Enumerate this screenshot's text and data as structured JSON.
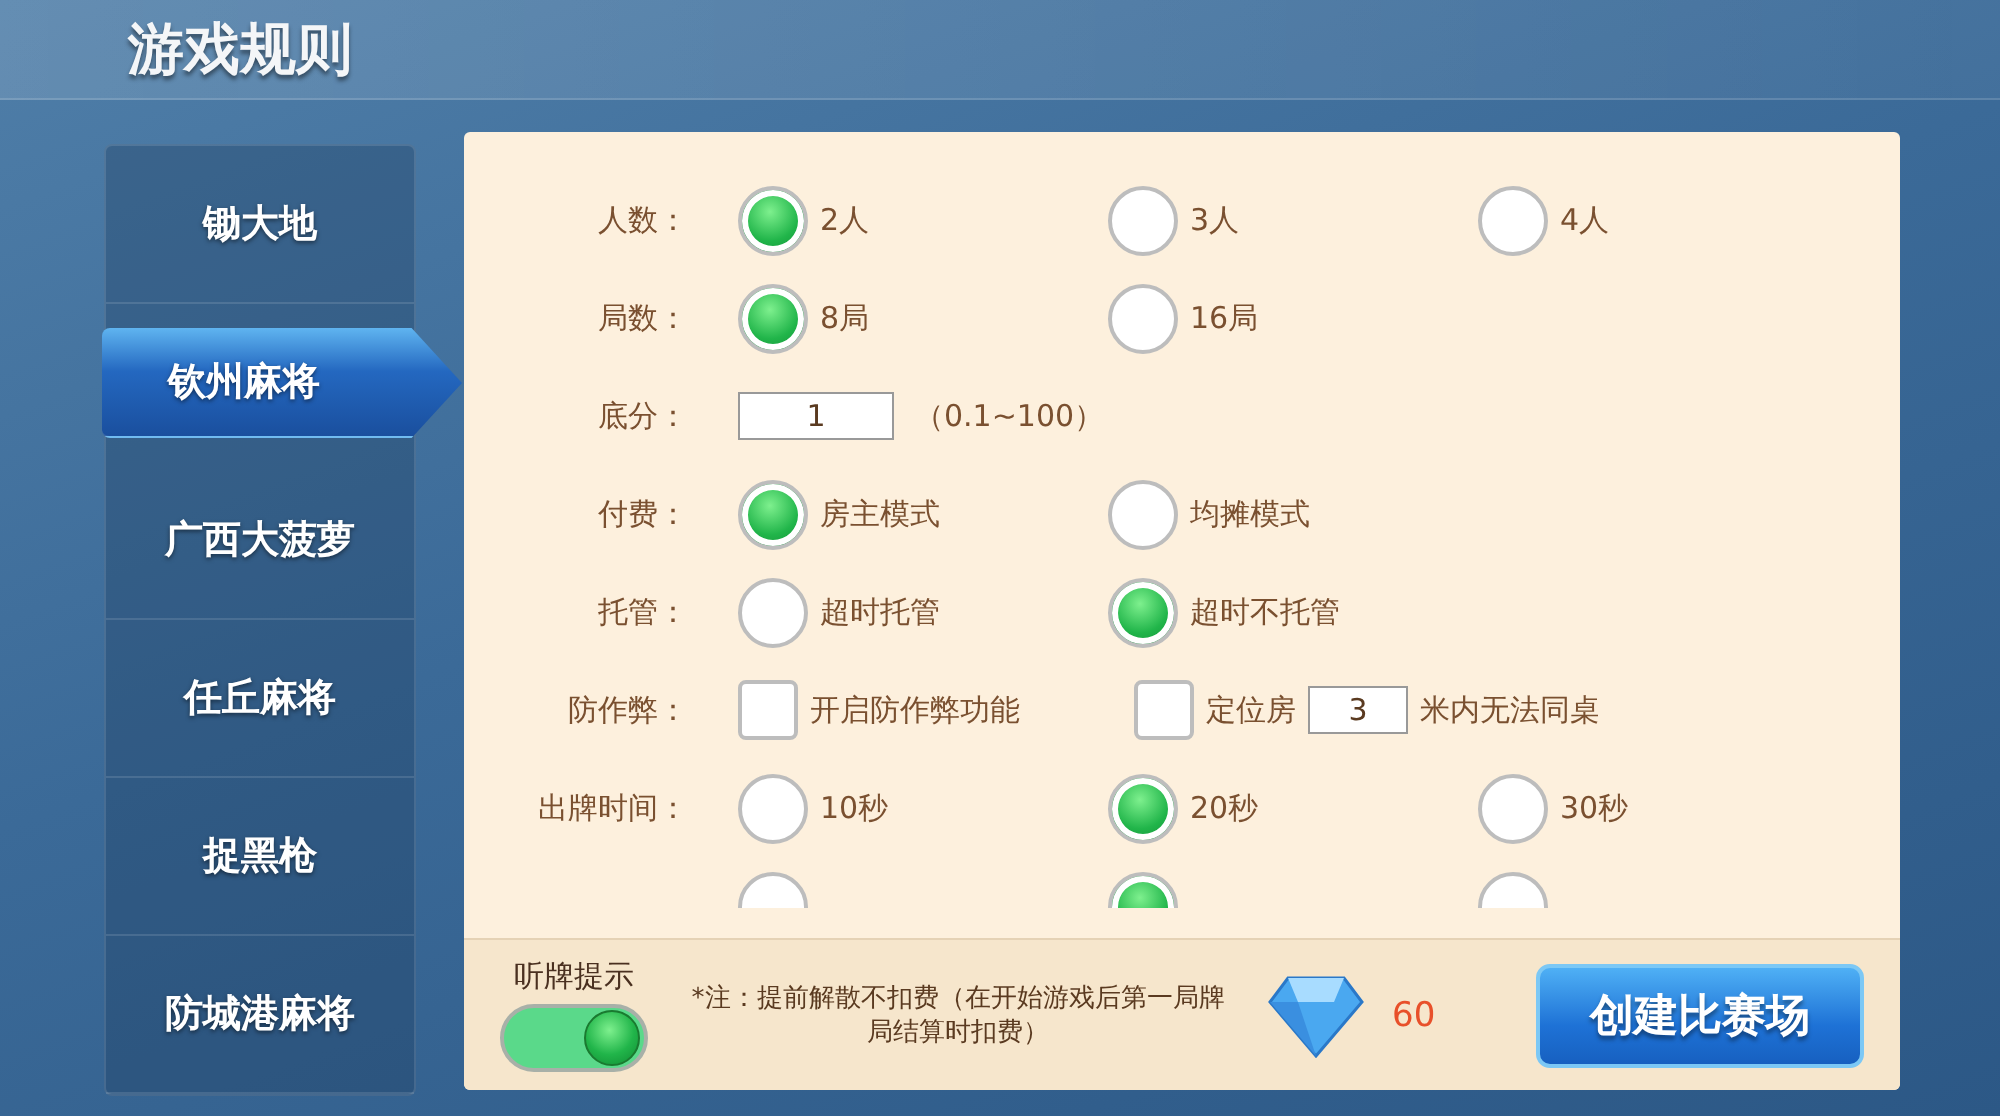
{
  "title": "游戏规则",
  "games": [
    {
      "label": "锄大地",
      "selected": false
    },
    {
      "label": "钦州麻将",
      "selected": true
    },
    {
      "label": "广西大菠萝",
      "selected": false
    },
    {
      "label": "任丘麻将",
      "selected": false
    },
    {
      "label": "捉黑枪",
      "selected": false
    },
    {
      "label": "防城港麻将",
      "selected": false
    }
  ],
  "rules": [
    {
      "kind": "radio",
      "label": "人数：",
      "options": [
        {
          "text": "2人",
          "selected": true
        },
        {
          "text": "3人",
          "selected": false
        },
        {
          "text": "4人",
          "selected": false
        }
      ]
    },
    {
      "kind": "radio",
      "label": "局数：",
      "options": [
        {
          "text": "8局",
          "selected": true
        },
        {
          "text": "16局",
          "selected": false
        }
      ]
    },
    {
      "kind": "input",
      "label": "底分：",
      "value": "1",
      "hint": "（0.1~100）"
    },
    {
      "kind": "radio",
      "label": "付费：",
      "options": [
        {
          "text": "房主模式",
          "selected": true
        },
        {
          "text": "均摊模式",
          "selected": false
        }
      ]
    },
    {
      "kind": "radio",
      "label": "托管：",
      "options": [
        {
          "text": "超时托管",
          "selected": false
        },
        {
          "text": "超时不托管",
          "selected": true
        }
      ]
    },
    {
      "kind": "check",
      "label": "防作弊：",
      "options": [
        {
          "text": "开启防作弊功能",
          "checked": false
        },
        {
          "text": "定位房",
          "checked": false,
          "value": "3",
          "suffix": "米内无法同桌"
        }
      ]
    },
    {
      "kind": "radio",
      "label": "出牌时间：",
      "options": [
        {
          "text": "10秒",
          "selected": false
        },
        {
          "text": "20秒",
          "selected": true
        },
        {
          "text": "30秒",
          "selected": false
        }
      ]
    },
    {
      "kind": "radio",
      "options": [
        {
          "selected": false
        },
        {
          "selected": true
        },
        {
          "selected": false
        }
      ]
    }
  ],
  "footer": {
    "toggle": {
      "label": "听牌提示",
      "on": true
    },
    "note": "*注：提前解散不扣费（在开始游戏后第一局牌局结算时扣费）",
    "cost": "60",
    "button": "创建比赛场"
  }
}
